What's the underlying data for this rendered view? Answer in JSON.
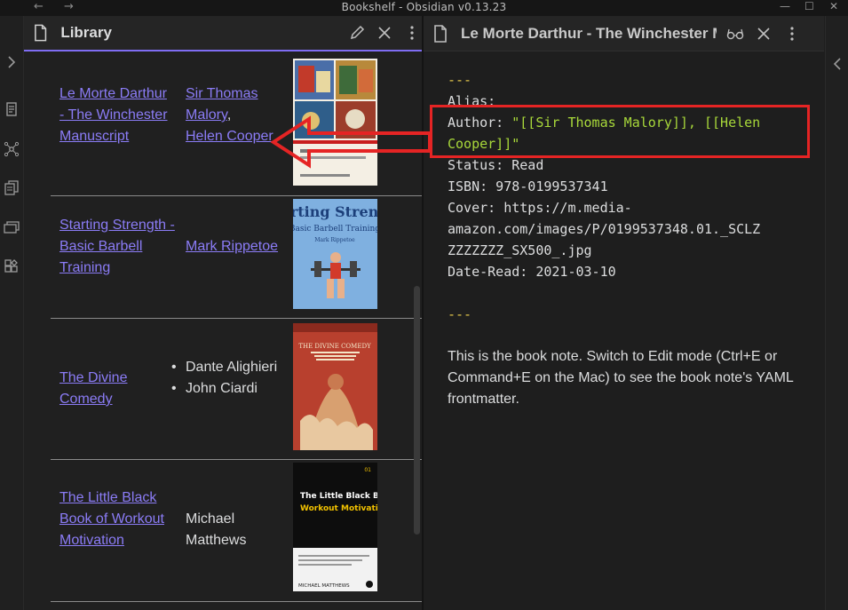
{
  "window": {
    "title": "Bookshelf - Obsidian v0.13.23"
  },
  "left_pane": {
    "title": "Library",
    "rows": [
      {
        "title": "Le Morte Darthur - The Winchester Manuscript",
        "authors_linked": [
          "Sir Thomas Malory",
          "Helen Cooper"
        ],
        "sep": ","
      },
      {
        "title": "Starting Strength - Basic Barbell Training",
        "authors_linked": [
          "Mark Rippetoe"
        ]
      },
      {
        "title": "The Divine Comedy",
        "authors_list": [
          "Dante Alighieri",
          "John Ciardi"
        ]
      },
      {
        "title": "The Little Black Book of Workout Motivation",
        "author_text": "Michael Matthews"
      }
    ],
    "covers": {
      "c2_title": "Starting Strength",
      "c2_sub": "Basic Barbell Training",
      "c2_author": "Mark Rippetoe",
      "c3_title": "THE DIVINE COMEDY",
      "c4_title_1": "The Little Black Book of",
      "c4_title_2": "Workout Motivation",
      "c4_num": "01",
      "c4_author": "MICHAEL MATTHEWS"
    }
  },
  "right_pane": {
    "title": "Le Morte Darthur - The Winchester Manuscript",
    "yaml": {
      "delim": "---",
      "alias_label": "Alias:",
      "author_label": "Author: ",
      "author_value_1": "\"[[Sir Thomas Malory]], [[Helen",
      "author_value_2": "Cooper]]\"",
      "status": "Status: Read",
      "isbn": "ISBN: 978-0199537341",
      "cover_1": "Cover: https://m.media-",
      "cover_2": "amazon.com/images/P/0199537348.01._SCLZ",
      "cover_3": "ZZZZZZZ_SX500_.jpg",
      "date": "Date-Read: 2021-03-10"
    },
    "body": "This is the book note. Switch to Edit mode (Ctrl+E or Command+E on the Mac) to see the book note's YAML frontmatter."
  },
  "colors": {
    "accent": "#7f6df2",
    "link": "#8b7cf6",
    "annotation": "#e52424",
    "yaml_key_value": "#a8d83a",
    "yaml_delim": "#e3c74b"
  }
}
